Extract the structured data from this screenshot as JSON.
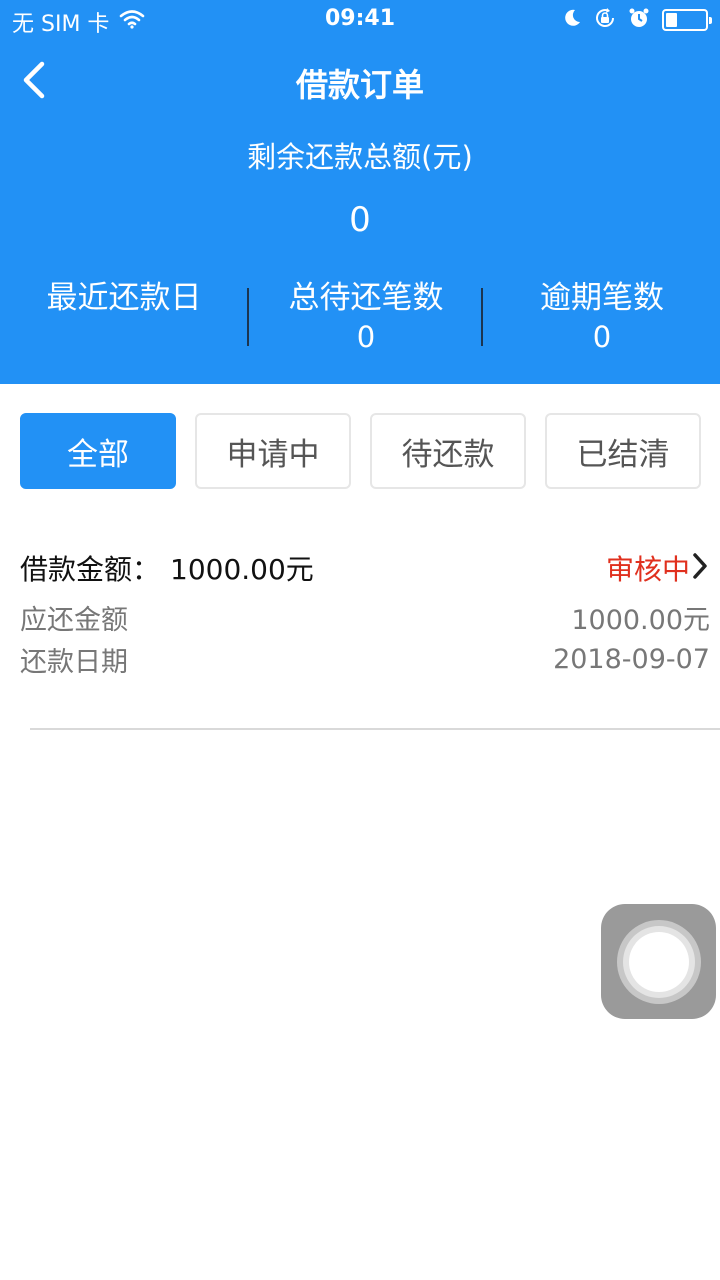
{
  "status_bar": {
    "carrier": "无 SIM 卡",
    "time": "09:41",
    "battery_level": 0.3
  },
  "nav": {
    "title": "借款订单"
  },
  "summary": {
    "remaining_label": "剩余还款总额(元)",
    "remaining_value": "0",
    "stats": [
      {
        "label": "最近还款日",
        "value": ""
      },
      {
        "label": "总待还笔数",
        "value": "0"
      },
      {
        "label": "逾期笔数",
        "value": "0"
      }
    ]
  },
  "tabs": [
    {
      "label": "全部",
      "active": true
    },
    {
      "label": "申请中",
      "active": false
    },
    {
      "label": "待还款",
      "active": false
    },
    {
      "label": "已结清",
      "active": false
    }
  ],
  "order": {
    "amount_label": "借款金额：",
    "amount_value": "1000.00元",
    "status": "审核中",
    "due_amount_label": "应还金额",
    "due_amount_value": "1000.00元",
    "due_date_label": "还款日期",
    "due_date_value": "2018-09-07"
  },
  "colors": {
    "primary": "#2291f5",
    "status_red": "#e0301e"
  },
  "icons": [
    "wifi-icon",
    "moon-icon",
    "rotation-lock-icon",
    "alarm-icon",
    "battery-icon",
    "back-arrow-icon",
    "chevron-right-icon",
    "assistive-touch-icon"
  ]
}
